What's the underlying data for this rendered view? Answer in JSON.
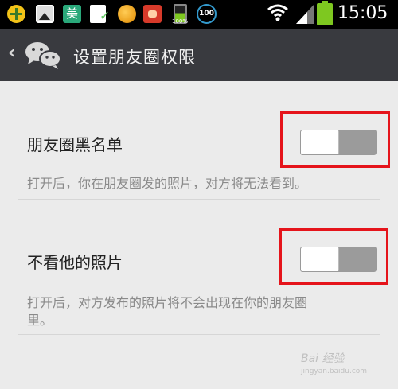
{
  "status_bar": {
    "icons": [
      "add-icon",
      "gallery-icon",
      "meituan-icon",
      "document-check-icon",
      "orange-app-icon",
      "face-app-icon",
      "battery-app-icon",
      "speed-100-icon",
      "wifi-icon",
      "signal-icon",
      "battery-icon"
    ],
    "mei_label": "美",
    "battery_small_label": "100%",
    "badge_100": "100",
    "time": "15:05"
  },
  "header": {
    "back_icon": "chevron-left-icon",
    "logo_icon": "wechat-icon",
    "title": "设置朋友圈权限",
    "background": "#393a3f"
  },
  "settings": [
    {
      "title": "朋友圈黑名单",
      "description": "打开后，你在朋友圈发的照片，对方将无法看到。",
      "toggle_on": false
    },
    {
      "title": "不看他的照片",
      "description_line1": "打开后，对方发布的照片将不会出现在你的朋友圈",
      "description_line2": "里。",
      "toggle_on": false
    }
  ],
  "watermark": {
    "text": "Bai 经验",
    "sub": "jingyan.baidu.com"
  },
  "colors": {
    "highlight": "#e5141b",
    "background": "#ebebeb"
  }
}
